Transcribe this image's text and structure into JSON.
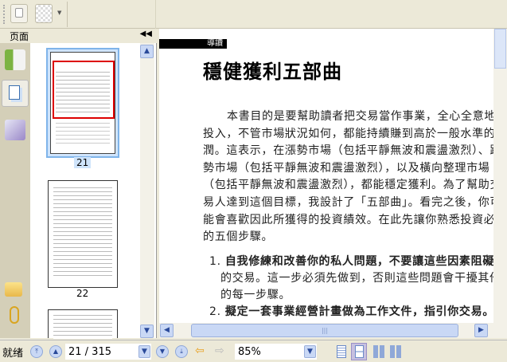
{
  "sidebar": {
    "title": "页面",
    "thumbnails": [
      {
        "page": "21"
      },
      {
        "page": "22"
      }
    ]
  },
  "document": {
    "section_label": "導讀",
    "title": "穩健獲利五部曲",
    "paragraph_lines": [
      "本書目的是要幫助讀者把交易當作事業，全心全意地",
      "投入，不管市場狀況如何，都能持續賺到高於一般水準的利",
      "潤。這表示，在漲勢市場（包括平靜無波和震盪激烈）、跌",
      "勢市場（包括平靜無波和震盪激烈），以及橫向整理市場",
      "（包括平靜無波和震盪激烈），都能穩定獲利。為了幫助交",
      "易人達到這個目標，我設計了「五部曲」。看完之後，你可",
      "能會喜歡因此所獲得的投資績效。在此先讓你熟悉投資必經",
      "的五個步驟。"
    ],
    "list": [
      {
        "num": "1.",
        "bold": "自我修練和改善你的私人問題，不要讓這些因素阻礙你",
        "lines": [
          "的交易。這一步必須先做到，否則這些問題會干擾其他",
          "的每一步驟。"
        ]
      },
      {
        "num": "2.",
        "bold": "擬定一套事業經營計畫做為工作文件，指引你交易。不",
        "lines": []
      }
    ]
  },
  "status": {
    "ready": "就绪",
    "page_input": "21 / 315",
    "zoom": "85%"
  }
}
